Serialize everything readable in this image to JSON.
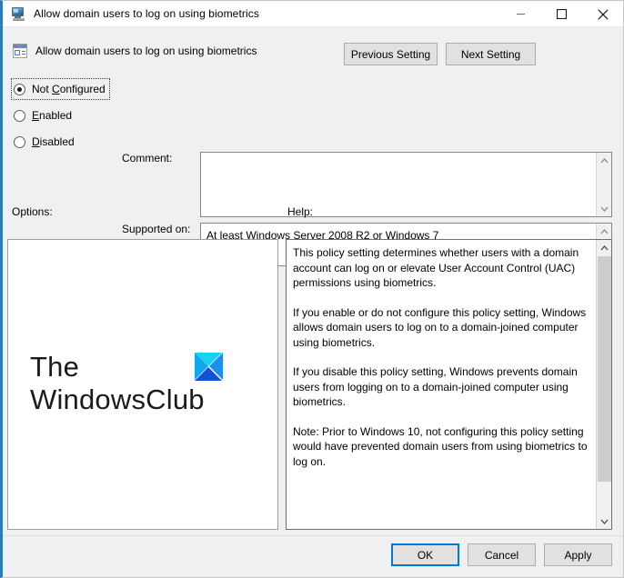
{
  "window": {
    "title": "Allow domain users to log on using biometrics",
    "icon": "computer-monitor-icon",
    "controls": {
      "minimize": "minimize-icon",
      "maximize": "maximize-icon",
      "close": "close-icon"
    }
  },
  "header": {
    "icon": "policy-setting-icon",
    "title": "Allow domain users to log on using biometrics",
    "previous_label": "Previous Setting",
    "next_label": "Next Setting"
  },
  "state_options": {
    "selected": "Not Configured",
    "items": [
      {
        "label": "Not Configured",
        "accel_before": "Not ",
        "accel": "C",
        "accel_after": "onfigured",
        "checked": true,
        "focused": true
      },
      {
        "label": "Enabled",
        "accel_before": "",
        "accel": "E",
        "accel_after": "nabled",
        "checked": false,
        "focused": false
      },
      {
        "label": "Disabled",
        "accel_before": "",
        "accel": "D",
        "accel_after": "isabled",
        "checked": false,
        "focused": false
      }
    ]
  },
  "comment": {
    "label": "Comment:",
    "value": "",
    "placeholder": ""
  },
  "supported_on": {
    "label": "Supported on:",
    "value": "At least Windows Server 2008 R2 or Windows 7"
  },
  "options": {
    "label": "Options:",
    "watermark": {
      "line1": "The",
      "line2": "WindowsClub",
      "logo_icon": "windowsclub-square-icon"
    }
  },
  "help": {
    "label": "Help:",
    "paragraphs": [
      "This policy setting determines whether users with a domain account can log on or elevate User Account Control (UAC) permissions using biometrics.",
      "If you enable or do not configure this policy setting, Windows allows domain users to log on to a domain-joined computer using biometrics.",
      "If you disable this policy setting, Windows prevents domain users from logging on to a domain-joined computer using biometrics.",
      "Note: Prior to Windows 10, not configuring this policy setting would have prevented domain users from using biometrics to log on."
    ]
  },
  "footer": {
    "ok_label": "OK",
    "cancel_label": "Cancel",
    "apply_label": "Apply"
  },
  "colors": {
    "accent": "#0078d7",
    "window_border_left": "#2b7cb9",
    "dialog_bg": "#f0f0f0",
    "logo_top": "#1ad0f0",
    "logo_left": "#12a6ef",
    "logo_right": "#1b8ef2",
    "logo_bottom": "#1152d8"
  }
}
